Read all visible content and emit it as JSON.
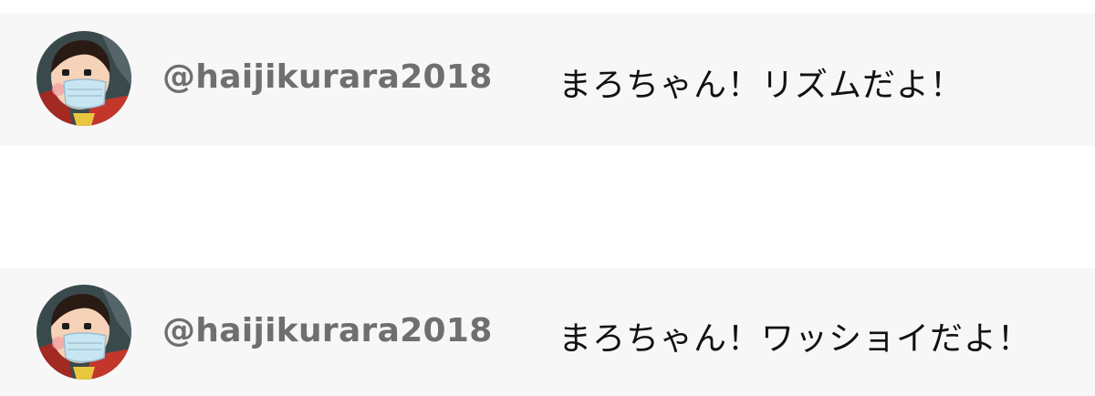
{
  "comments": [
    {
      "username": "@haijikurara2018",
      "text": "まろちゃん！リズムだよ！",
      "avatar_icon": "anime-girl-mask-avatar-icon"
    },
    {
      "username": "@haijikurara2018",
      "text": "まろちゃん！ワッショイだよ！",
      "avatar_icon": "anime-girl-mask-avatar-icon"
    }
  ],
  "colors": {
    "row_background": "#f7f7f8",
    "username": "#6f6f6f",
    "message": "#111111"
  }
}
